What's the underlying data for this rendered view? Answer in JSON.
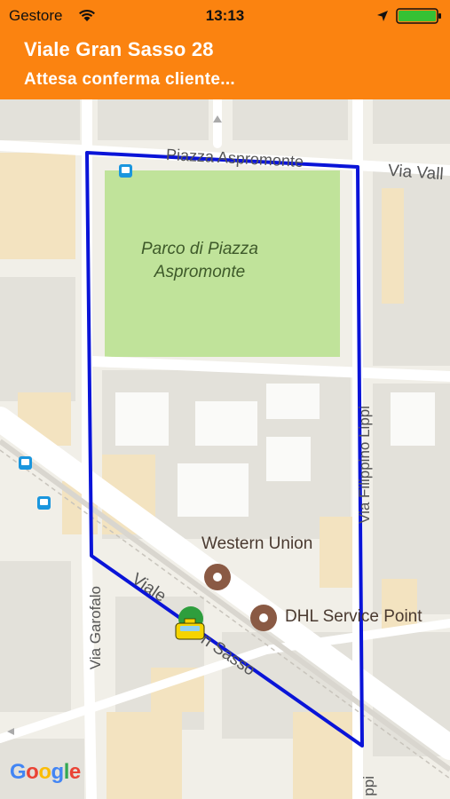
{
  "status_bar": {
    "carrier": "Gestore",
    "time": "13:13",
    "wifi_icon": "wifi-icon",
    "location_icon": "location-arrow-icon",
    "battery_icon": "battery-icon"
  },
  "header": {
    "address": "Viale Gran Sasso 28",
    "status": "Attesa conferma cliente...",
    "color": "#fb8310"
  },
  "map": {
    "streets": {
      "piazza_aspromonte": "Piazza Aspromonte",
      "via_vall": "Via Vall",
      "via_filippino_lippi": "Via Filippino Lippi",
      "viale_gran_sasso_a": "Viale",
      "viale_gran_sasso_b": "n Sasso",
      "via_garofalo": "Via Garofalo",
      "lippi_bottom": "ppi"
    },
    "park": "Parco di Piazza\nAspromonte",
    "pois": {
      "western_union": "Western Union",
      "dhl": "DHL Service Point"
    },
    "attribution": "Google",
    "area_color": "#0a14d8",
    "park_color": "#c0e39a",
    "icons": [
      "bus-stop-icon",
      "shop-icon",
      "taxi-icon"
    ]
  }
}
